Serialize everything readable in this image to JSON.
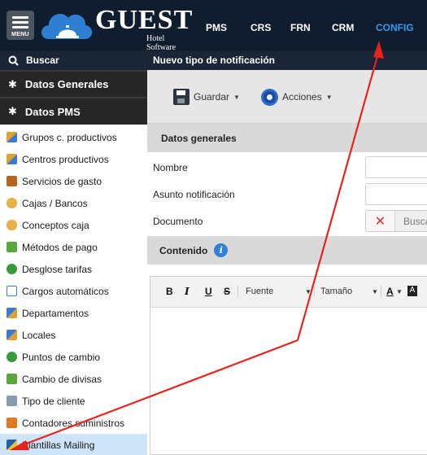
{
  "header": {
    "menu_label": "MENU",
    "logo_text": "GUEST",
    "logo_sub": "Hotel Software",
    "nav": [
      "PMS",
      "CRS",
      "FRN",
      "CRM",
      "CONFIG"
    ],
    "active_nav": "CONFIG"
  },
  "sidebar": {
    "search_label": "Buscar",
    "sections": [
      "Datos Generales",
      "Datos PMS"
    ],
    "items": [
      "Grupos c. productivos",
      "Centros productivos",
      "Servicios de gasto",
      "Cajas / Bancos",
      "Conceptos caja",
      "Métodos de pago",
      "Desglose tarifas",
      "Cargos automáticos",
      "Departamentos",
      "Locales",
      "Puntos de cambio",
      "Cambio de divisas",
      "Tipo de cliente",
      "Contadores suministros",
      "Plantillas Mailing"
    ],
    "selected_item": "Plantillas Mailing"
  },
  "main": {
    "title": "Nuevo tipo de notificación",
    "toolbar": {
      "save_label": "Guardar",
      "actions_label": "Acciones"
    },
    "general_section": "Datos generales",
    "fields": {
      "nombre": "Nombre",
      "asunto": "Asunto notificación",
      "documento": "Documento"
    },
    "documento_search": "Busca",
    "content_section": "Contenido",
    "editor": {
      "bold": "B",
      "italic": "I",
      "underline": "U",
      "strike": "S",
      "font_label": "Fuente",
      "size_label": "Tamaño",
      "color_label": "A"
    }
  },
  "colors": {
    "header_bg": "#0f1d2e",
    "active_nav": "#2e9cf0",
    "annotation": "#e8231c",
    "selected_row": "#cde4f9"
  }
}
